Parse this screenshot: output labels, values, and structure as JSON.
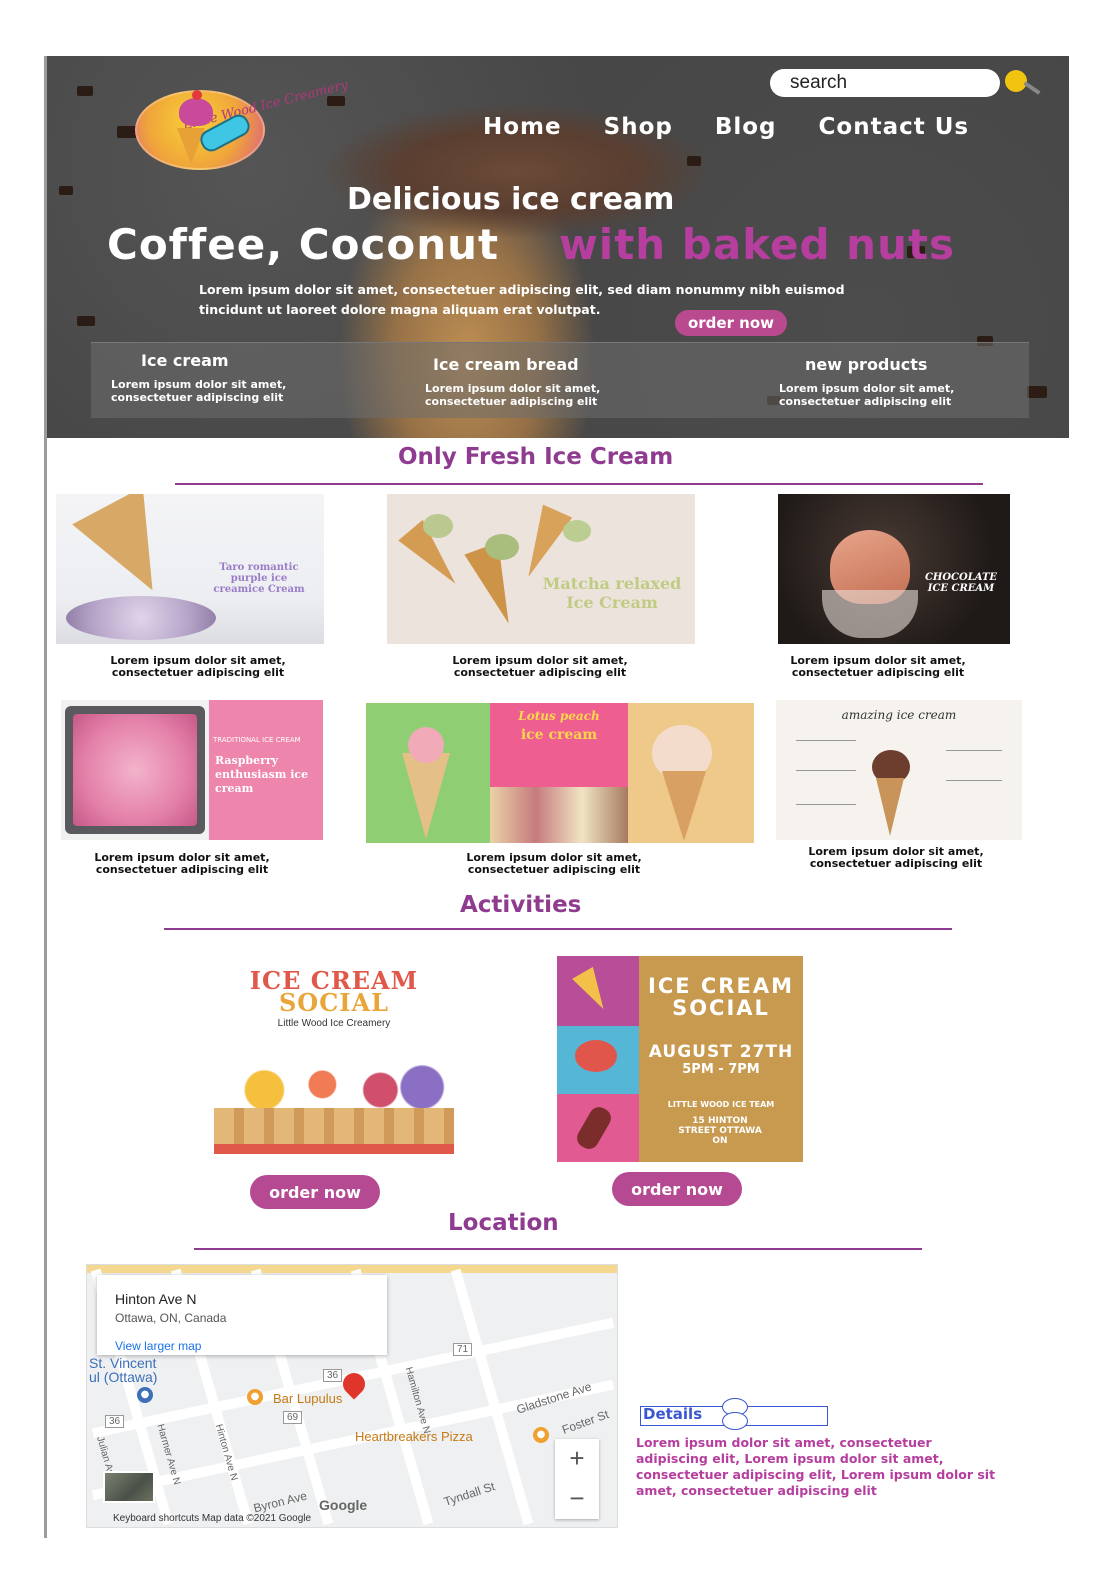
{
  "brand": {
    "logo_script": "Little Wood Ice Creamery"
  },
  "header": {
    "search_placeholder": "search",
    "nav": [
      "Home",
      "Shop",
      "Blog",
      "Contact Us"
    ]
  },
  "hero": {
    "subtitle": "Delicious ice cream",
    "title": "Coffee, Coconut",
    "title_accent": "with baked nuts",
    "body": "Lorem ipsum dolor sit amet, consectetuer adipiscing elit, sed diam nonummy nibh euismod tincidunt ut laoreet dolore magna aliquam erat volutpat.",
    "cta": "order now"
  },
  "features": [
    {
      "title": "Ice cream",
      "text": "Lorem ipsum dolor sit amet, consectetuer adipiscing elit"
    },
    {
      "title": "Ice cream bread",
      "text": "Lorem ipsum dolor sit amet, consectetuer adipiscing elit"
    },
    {
      "title": "new products",
      "text": "Lorem ipsum dolor sit amet, consectetuer adipiscing elit"
    }
  ],
  "fresh": {
    "title": "Only Fresh Ice Cream",
    "cards": [
      {
        "label": "Taro romantic purple ice creamice Cream",
        "text": "Lorem ipsum dolor sit amet, consectetuer adipiscing elit"
      },
      {
        "label": "Matcha relaxed Ice Cream",
        "text": "Lorem ipsum dolor sit amet, consectetuer adipiscing elit"
      },
      {
        "label": "CHOCOLATE ICE CREAM",
        "text": "Lorem ipsum dolor sit amet, consectetuer adipiscing elit"
      },
      {
        "label": "Raspberry enthusiasm ice cream",
        "small": "TRADITIONAL ICE CREAM",
        "text": "Lorem ipsum dolor sit amet, consectetuer adipiscing elit"
      },
      {
        "label": "Lotus peach",
        "label2": "ice cream",
        "text": "Lorem ipsum dolor sit amet, consectetuer adipiscing elit"
      },
      {
        "label": "amazing ice cream",
        "text": "Lorem ipsum dolor sit amet, consectetuer adipiscing elit"
      }
    ]
  },
  "activities": {
    "title": "Activities",
    "poster1": {
      "title": "ICE CREAM",
      "title2": "SOCIAL",
      "sub": "Little Wood Ice Creamery"
    },
    "poster2": {
      "title": "ICE CREAM",
      "title2": "SOCIAL",
      "date": "AUGUST 27TH",
      "time": "5PM - 7PM",
      "venue": "LITTLE WOOD ICE TEAM",
      "addr": "15 HINTON STREET OTTAWA ON"
    },
    "buttons": [
      "order now",
      "order now"
    ]
  },
  "location": {
    "title": "Location",
    "map": {
      "place": "Hinton Ave N",
      "city": "Ottawa, ON, Canada",
      "link": "View larger map",
      "labels": [
        "St. Vincent",
        "ul (Ottawa)",
        "Bar Lupulus",
        "Heartbreakers Pizza",
        "Gladstone Ave",
        "Byron Ave",
        "Tyndall St",
        "Foster St",
        "Hamilton Ave N",
        "Hinton Ave N",
        "Harmer Ave N",
        "Julian Ave"
      ],
      "route_badges": [
        "71",
        "36",
        "69",
        "36"
      ],
      "footer": "Keyboard shortcuts    Map data ©2021 Google",
      "google": "Google"
    }
  },
  "details": {
    "title": "Details",
    "text": "Lorem ipsum dolor sit amet, consectetuer adipiscing elit,   Lorem ipsum dolor sit amet, consectetuer adipiscing elit,   Lorem ipsum dolor sit amet, consectetuer adipiscing elit"
  },
  "colors": {
    "accent": "#8e3b90",
    "button": "#b54a93",
    "hero_accent": "#b63e9e",
    "details_blue": "#3a56d0"
  }
}
